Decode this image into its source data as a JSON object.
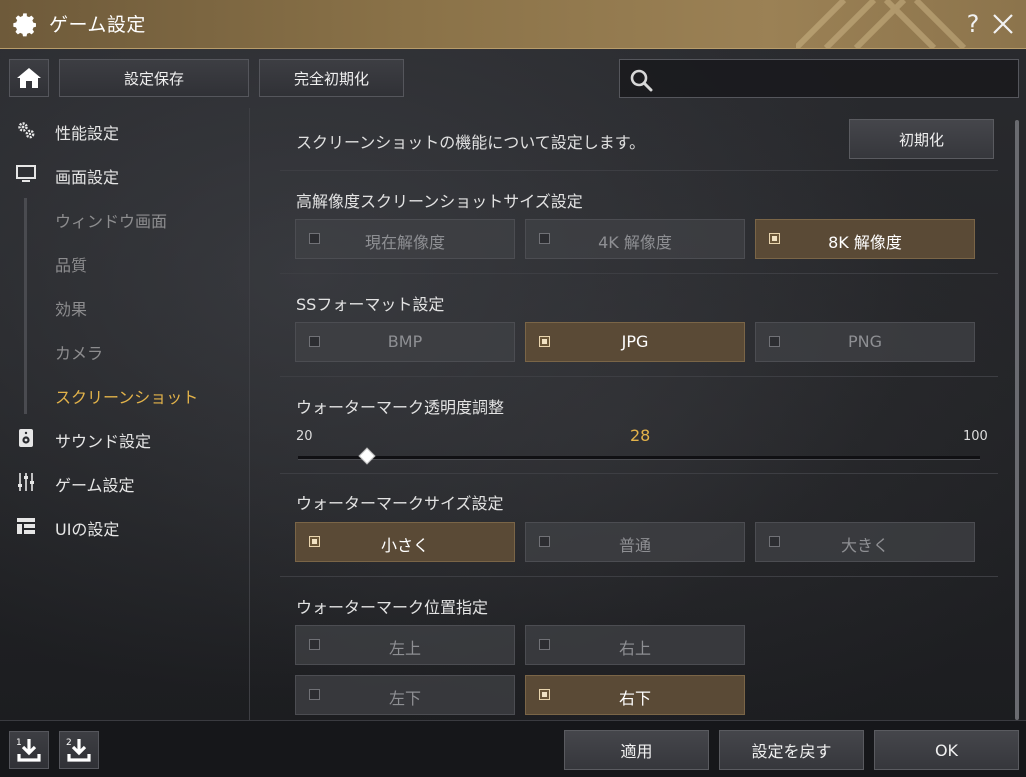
{
  "window": {
    "title": "ゲーム設定",
    "help_label": "?"
  },
  "toolbar": {
    "save_label": "設定保存",
    "reset_all_label": "完全初期化",
    "search": {
      "value": "",
      "placeholder": ""
    }
  },
  "sidebar": {
    "items": [
      {
        "label": "性能設定",
        "icon": "gears-icon"
      },
      {
        "label": "画面設定",
        "icon": "monitor-icon"
      },
      {
        "label": "サウンド設定",
        "icon": "speaker-icon"
      },
      {
        "label": "ゲーム設定",
        "icon": "sliders-icon"
      },
      {
        "label": "UIの設定",
        "icon": "layout-icon"
      }
    ],
    "sub_items": [
      {
        "label": "ウィンドウ画面"
      },
      {
        "label": "品質"
      },
      {
        "label": "効果"
      },
      {
        "label": "カメラ"
      },
      {
        "label": "スクリーンショット"
      }
    ],
    "active_sub_index": 4
  },
  "content": {
    "description": "スクリーンショットの機能について設定します。",
    "init_label": "初期化",
    "sections": {
      "resolution": {
        "title": "高解像度スクリーンショットサイズ設定",
        "options": [
          "現在解像度",
          "4K 解像度",
          "8K 解像度"
        ],
        "selected": 2
      },
      "format": {
        "title": "SSフォーマット設定",
        "options": [
          "BMP",
          "JPG",
          "PNG"
        ],
        "selected": 1
      },
      "watermark_opacity": {
        "title": "ウォーターマーク透明度調整",
        "min": "20",
        "max": "100",
        "value": "28",
        "fraction": 0.1
      },
      "watermark_size": {
        "title": "ウォーターマークサイズ設定",
        "options": [
          "小さく",
          "普通",
          "大きく"
        ],
        "selected": 0
      },
      "watermark_position": {
        "title": "ウォーターマーク位置指定",
        "options": [
          "左上",
          "右上",
          "左下",
          "右下"
        ],
        "selected": 3
      }
    }
  },
  "footer": {
    "apply_label": "適用",
    "revert_label": "設定を戻す",
    "ok_label": "OK",
    "slot1_label": "1",
    "slot2_label": "2"
  },
  "colors": {
    "accent": "#e3b34a",
    "title_bar": "#8a7248",
    "selected_option": "#5a4a36"
  }
}
